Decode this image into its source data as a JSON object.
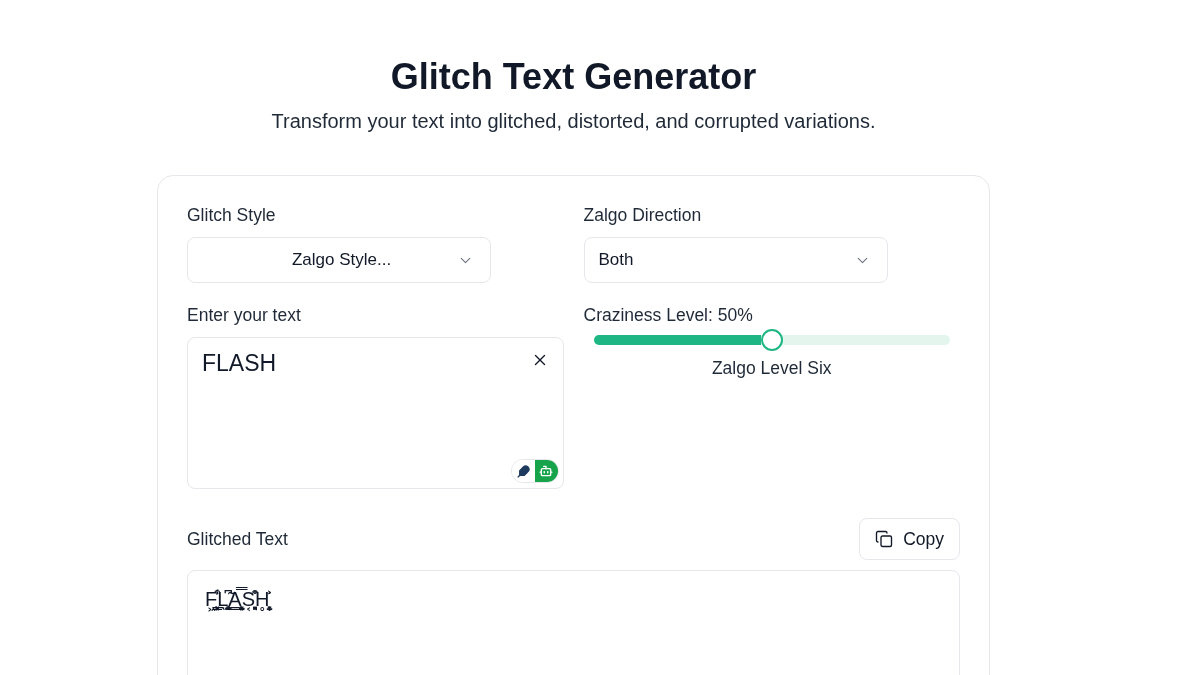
{
  "header": {
    "title": "Glitch Text Generator",
    "subtitle": "Transform your text into glitched, distorted, and corrupted variations."
  },
  "glitch_style": {
    "label": "Glitch Style",
    "value": "Zalgo Style..."
  },
  "zalgo_direction": {
    "label": "Zalgo Direction",
    "value": "Both"
  },
  "text_input": {
    "label": "Enter your text",
    "value": "FLASH",
    "modes": [
      {
        "kind": "feather",
        "selected": false
      },
      {
        "kind": "robot",
        "selected": true
      }
    ]
  },
  "craziness": {
    "label": "Craziness Level: 50%",
    "level": 0.5,
    "caption": "Zalgo Level Six"
  },
  "output": {
    "label": "Glitched Text",
    "copy_button": "Copy",
    "value": "F͖͙͓͕͇̾͒L̖̫̥͈͔̤̃͆A͇̮̤̹͙͓̖̿S͔͉̟͈͒̑H̥͎̤͓̦͐̇ͅ"
  }
}
